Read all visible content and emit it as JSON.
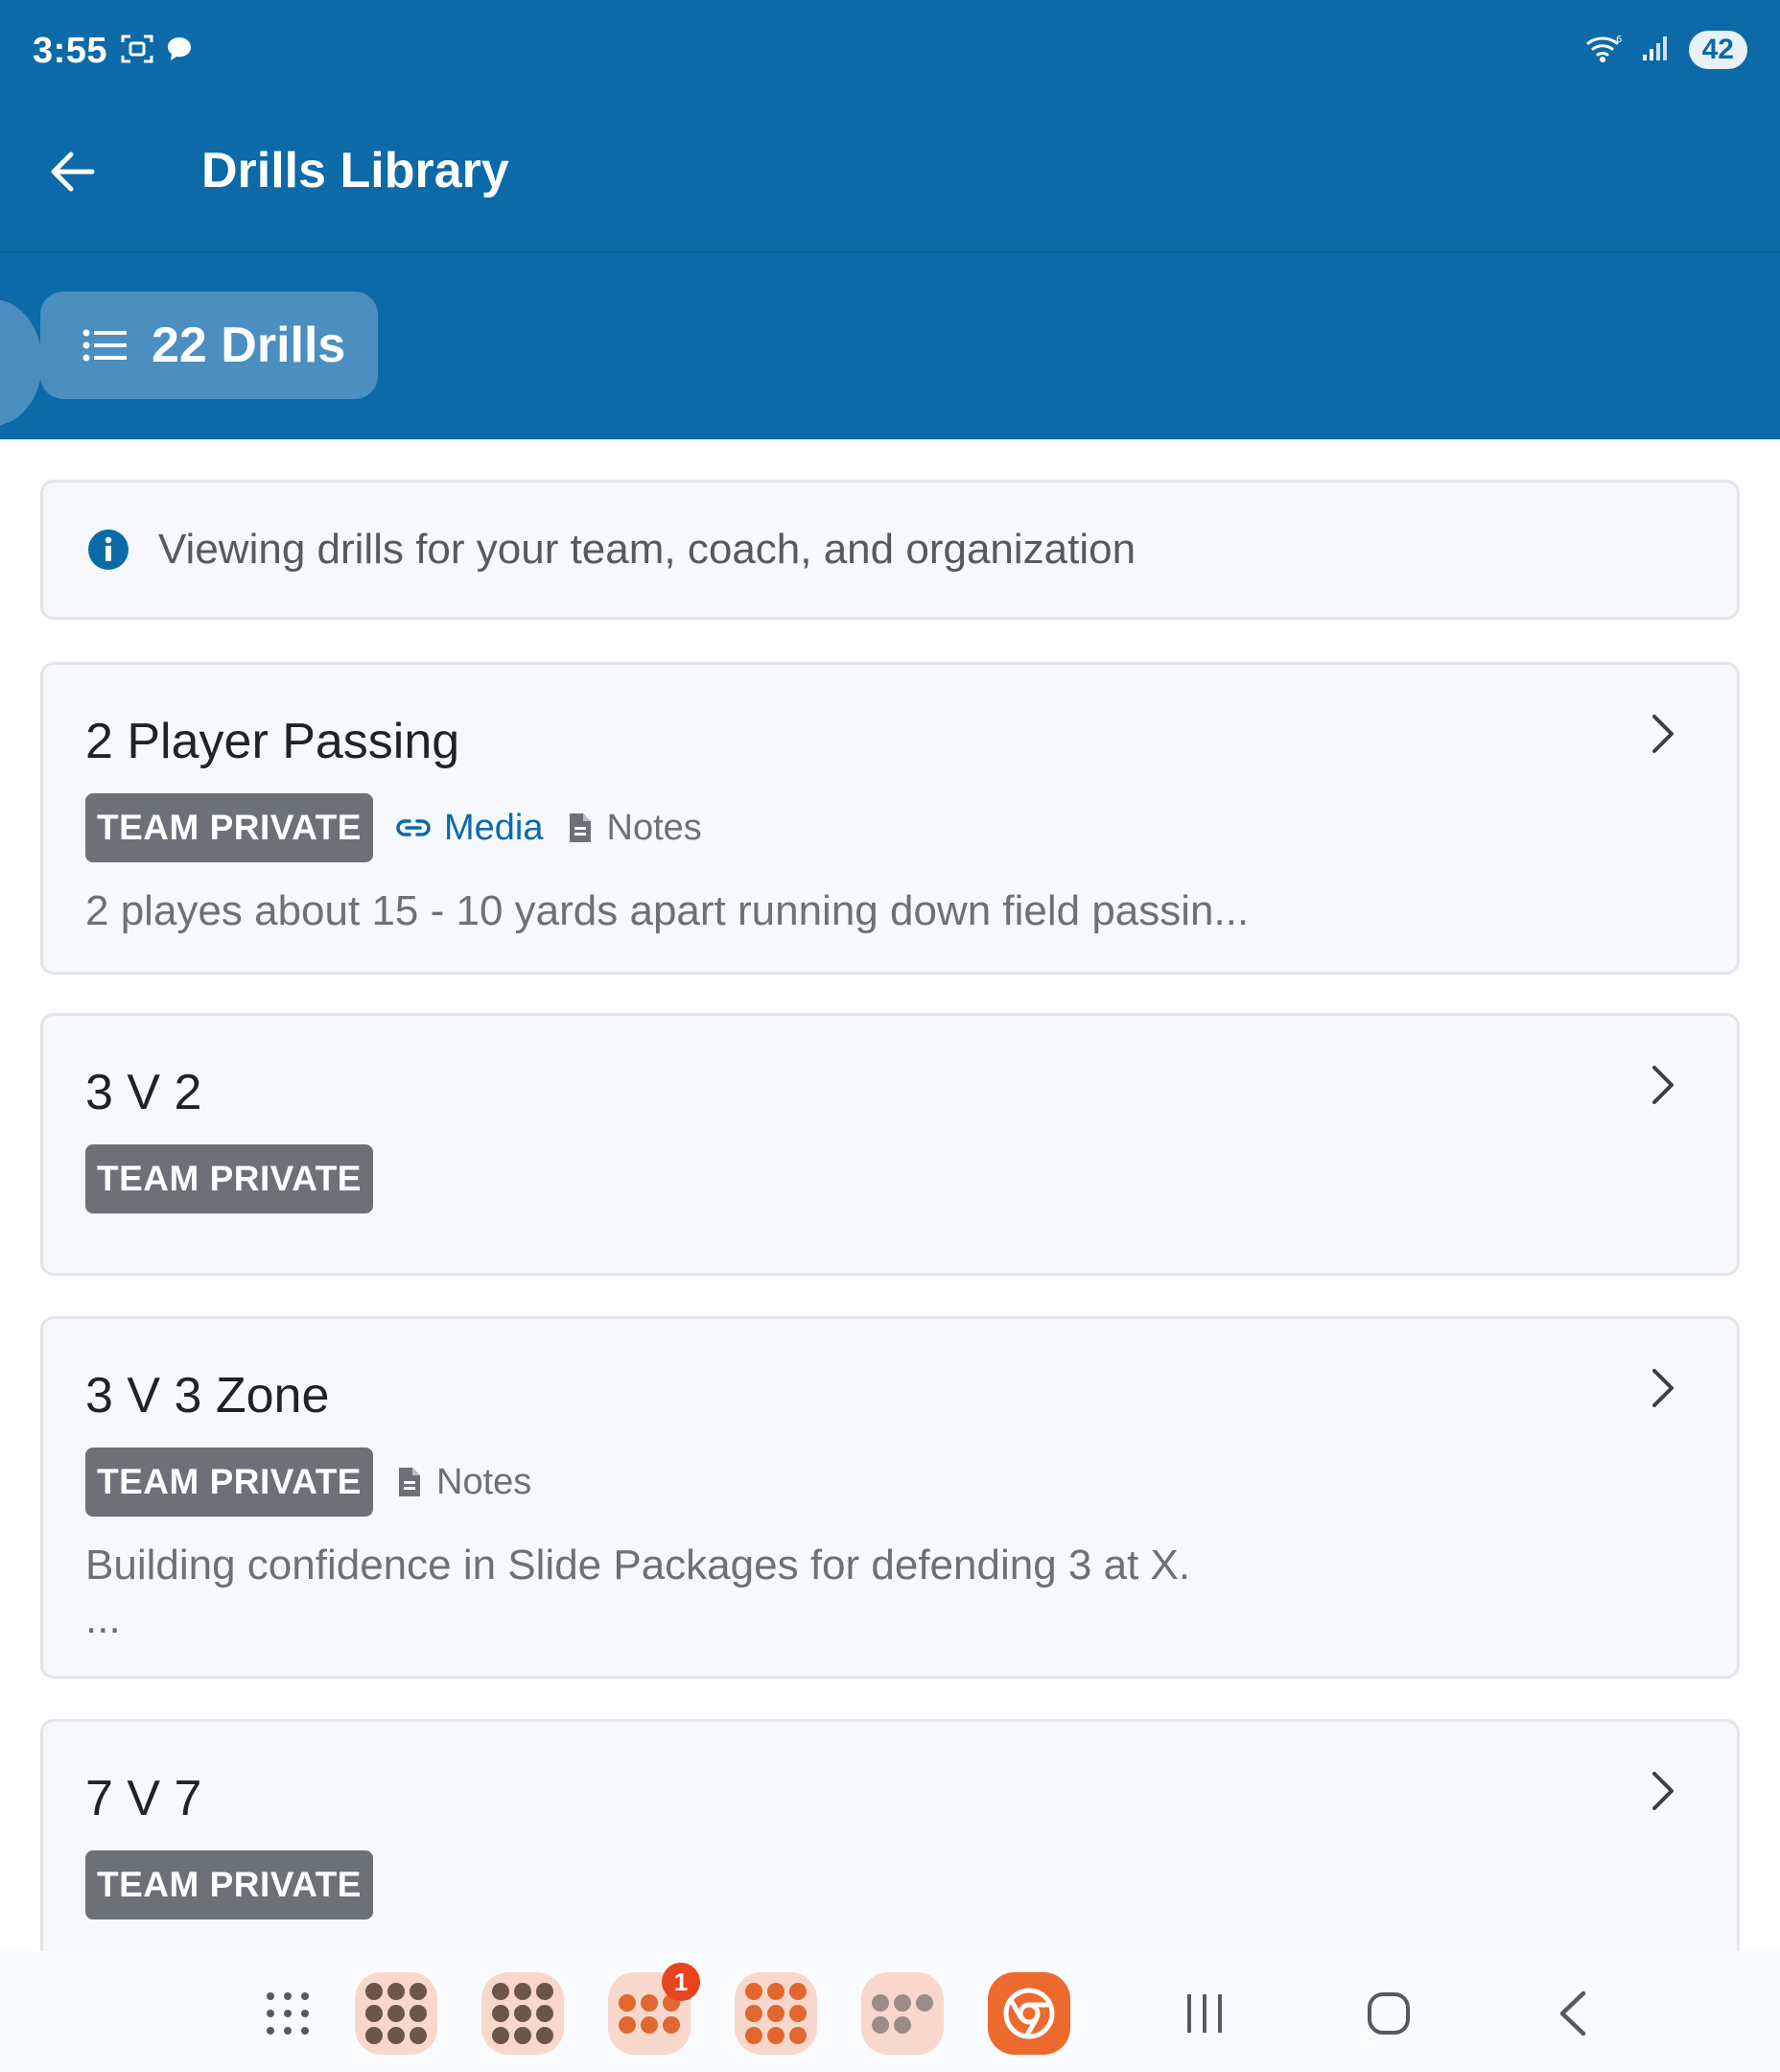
{
  "status_bar": {
    "time": "3:55",
    "battery": "42"
  },
  "app_bar": {
    "title": "Drills Library",
    "back_icon": "arrow-left-icon"
  },
  "drill_count": {
    "label": "22 Drills",
    "icon": "list-icon"
  },
  "info": {
    "text": "Viewing drills for your team, coach, and organization",
    "icon": "info-circle-icon"
  },
  "drills": [
    {
      "title": "2 Player Passing",
      "badge": "TEAM PRIVATE",
      "media_label": "Media",
      "notes_label": "Notes",
      "description": "2 playes about 15 - 10 yards apart running down field passin..."
    },
    {
      "title": "3 V 2",
      "badge": "TEAM PRIVATE"
    },
    {
      "title": "3 V 3 Zone",
      "badge": "TEAM PRIVATE",
      "notes_label": "Notes",
      "description": "Building confidence in Slide Packages for defending 3 at X.",
      "description_more": "..."
    },
    {
      "title": "7 V 7",
      "badge": "TEAM PRIVATE"
    }
  ],
  "nav_bar": {
    "notification_count": "1"
  },
  "colors": {
    "primary": "#0b6aa7",
    "pill": "#4a8fc0",
    "badge": "#6b7177",
    "card_bg": "#f6f8fb",
    "card_border": "#e2e5ea"
  }
}
